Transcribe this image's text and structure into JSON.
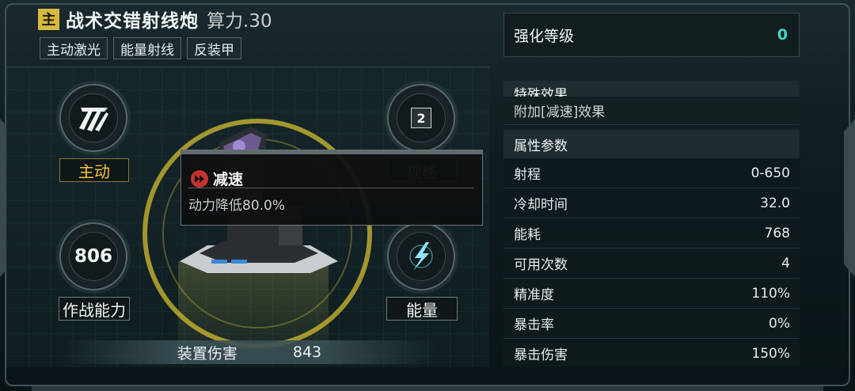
{
  "header": {
    "badge": "主",
    "title": "战术交错射线炮",
    "power": "算力.30",
    "tags": [
      "主动激光",
      "能量射线",
      "反装甲"
    ]
  },
  "left": {
    "mode_label": "主动",
    "combat_value": "806",
    "combat_label": "作战能力",
    "level_value": "2",
    "spec_label": "规格",
    "energy_label": "能量",
    "damage_label": "装置伤害",
    "damage_value": "843"
  },
  "tooltip": {
    "title": "减速",
    "desc": "动力降低80.0%"
  },
  "right": {
    "enhance_label": "强化等级",
    "enhance_value": "0",
    "special_label": "特殊效果",
    "special_effect": "附加[减速]效果",
    "attr_label": "属性参数",
    "stats": [
      {
        "label": "射程",
        "value": "0-650"
      },
      {
        "label": "冷却时间",
        "value": "32.0"
      },
      {
        "label": "能耗",
        "value": "768"
      },
      {
        "label": "可用次数",
        "value": "4"
      },
      {
        "label": "精准度",
        "value": "110%"
      },
      {
        "label": "暴击率",
        "value": "0%"
      },
      {
        "label": "暴击伤害",
        "value": "150%"
      }
    ]
  },
  "colors": {
    "accent_gold": "#d7b93e",
    "enhance_value": "#3fd6c4",
    "slow_icon": "#c6332f"
  }
}
